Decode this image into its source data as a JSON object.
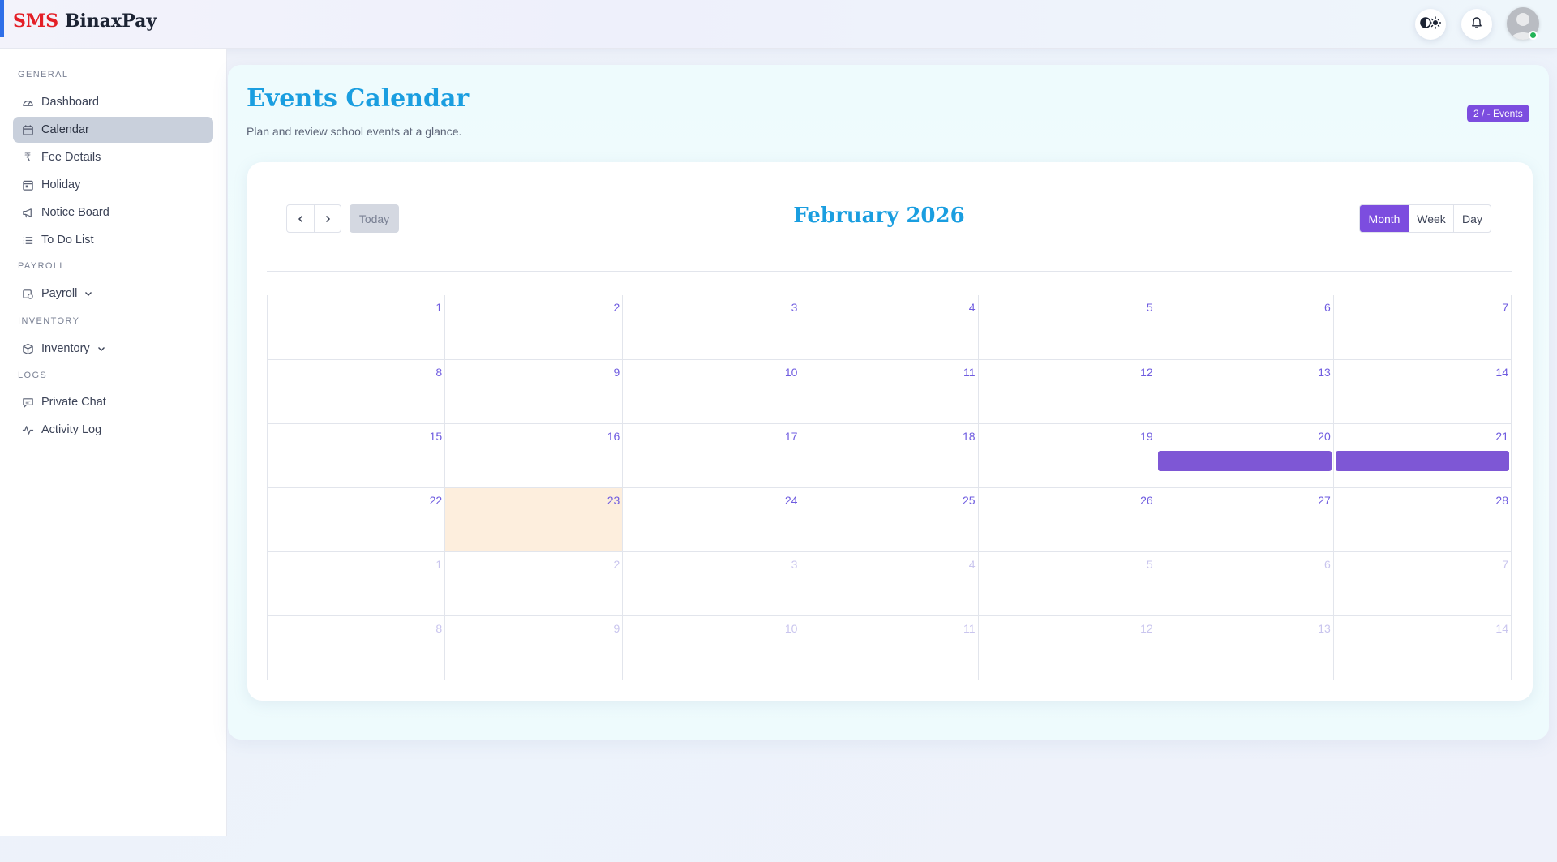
{
  "header": {
    "brand_sms": "SMS",
    "brand_name": "BinaxPay",
    "theme_toggle_icon": "contrast-sun-icon",
    "notifications_icon": "bell-icon",
    "avatar_status_color": "#22b357"
  },
  "sidebar": {
    "sections": {
      "general": "GENERAL",
      "payroll": "PAYROLL",
      "inventory": "INVENTORY",
      "logs": "LOGS"
    },
    "items": [
      {
        "label": "Dashboard",
        "icon": "gauge-icon"
      },
      {
        "label": "Calendar",
        "icon": "calendar-icon",
        "active": true
      },
      {
        "label": "Fee Details",
        "icon": "rupee-icon"
      },
      {
        "label": "Holiday",
        "icon": "holiday-icon"
      },
      {
        "label": "Notice Board",
        "icon": "megaphone-icon"
      },
      {
        "label": "To Do List",
        "icon": "list-icon"
      },
      {
        "label": "Payroll",
        "icon": "payroll-icon"
      },
      {
        "label": "Inventory",
        "icon": "box-icon"
      },
      {
        "label": "Private Chat",
        "icon": "chat-icon"
      },
      {
        "label": "Activity Log",
        "icon": "activity-icon"
      }
    ]
  },
  "page": {
    "title": "Events Calendar",
    "subtitle": "Plan and review school events at a glance.",
    "badge": "2 / - Events"
  },
  "calendar": {
    "title": "February 2026",
    "today_label": "Today",
    "prev_icon": "chevron-left-icon",
    "next_icon": "chevron-right-icon",
    "views": [
      "Month",
      "Week",
      "Day"
    ],
    "active_view": "Month",
    "today_date": "23",
    "accent_color": "#7c4ddf",
    "event_color": "#7e57d5",
    "today_color": "#fdeedd",
    "weeks": [
      [
        {
          "d": "1"
        },
        {
          "d": "2"
        },
        {
          "d": "3"
        },
        {
          "d": "4"
        },
        {
          "d": "5"
        },
        {
          "d": "6"
        },
        {
          "d": "7"
        }
      ],
      [
        {
          "d": "8"
        },
        {
          "d": "9"
        },
        {
          "d": "10"
        },
        {
          "d": "11"
        },
        {
          "d": "12"
        },
        {
          "d": "13"
        },
        {
          "d": "14"
        }
      ],
      [
        {
          "d": "15"
        },
        {
          "d": "16"
        },
        {
          "d": "17"
        },
        {
          "d": "18"
        },
        {
          "d": "19"
        },
        {
          "d": "20",
          "event": true
        },
        {
          "d": "21",
          "event": true
        }
      ],
      [
        {
          "d": "22"
        },
        {
          "d": "23",
          "today": true
        },
        {
          "d": "24"
        },
        {
          "d": "25"
        },
        {
          "d": "26"
        },
        {
          "d": "27"
        },
        {
          "d": "28"
        }
      ],
      [
        {
          "d": "1",
          "other": true
        },
        {
          "d": "2",
          "other": true
        },
        {
          "d": "3",
          "other": true
        },
        {
          "d": "4",
          "other": true
        },
        {
          "d": "5",
          "other": true
        },
        {
          "d": "6",
          "other": true
        },
        {
          "d": "7",
          "other": true
        }
      ],
      [
        {
          "d": "8",
          "other": true
        },
        {
          "d": "9",
          "other": true
        },
        {
          "d": "10",
          "other": true
        },
        {
          "d": "11",
          "other": true
        },
        {
          "d": "12",
          "other": true
        },
        {
          "d": "13",
          "other": true
        },
        {
          "d": "14",
          "other": true
        }
      ]
    ]
  }
}
